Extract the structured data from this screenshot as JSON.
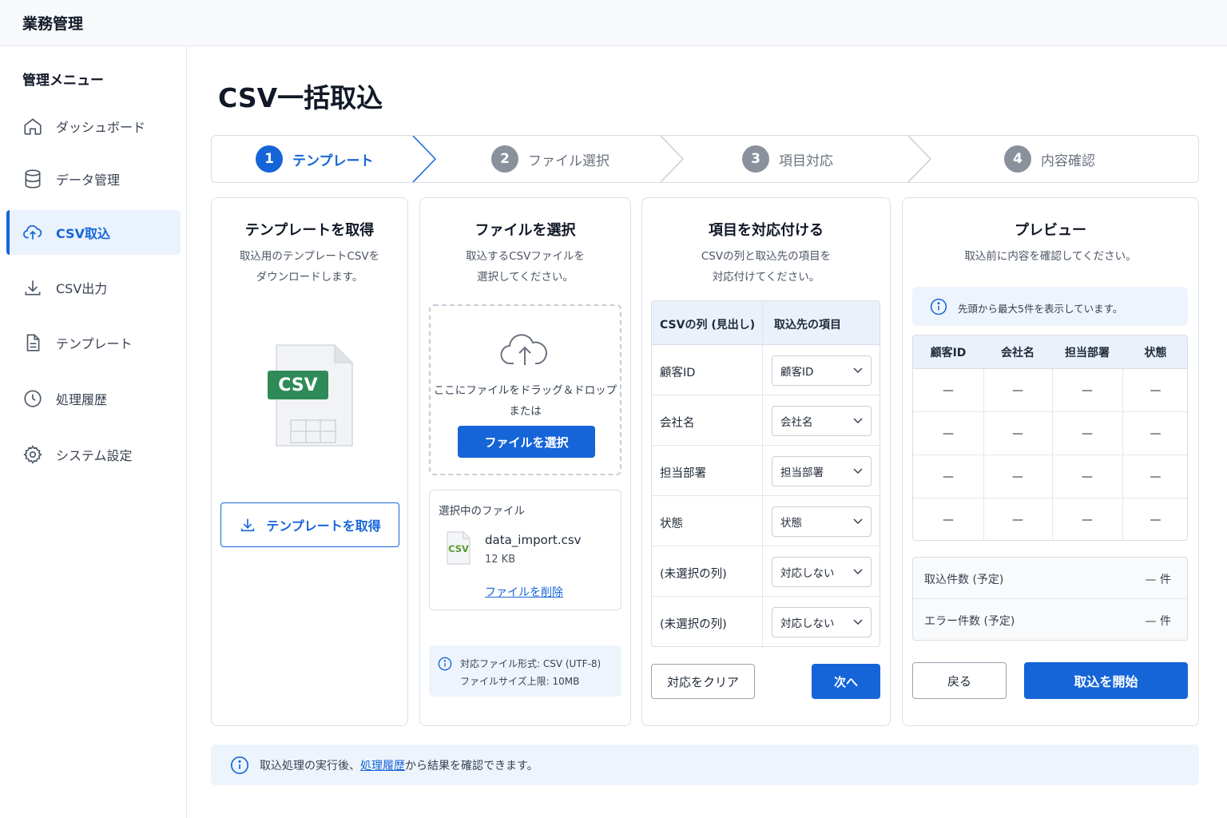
{
  "app": {
    "title": "業務管理"
  },
  "sidebar": {
    "title": "管理メニュー",
    "items": [
      {
        "label": "ダッシュボード",
        "icon": "home-icon"
      },
      {
        "label": "データ管理",
        "icon": "database-icon"
      },
      {
        "label": "CSV取込",
        "icon": "cloud-upload-icon",
        "active": true
      },
      {
        "label": "CSV出力",
        "icon": "download-icon"
      },
      {
        "label": "テンプレート",
        "icon": "document-icon"
      },
      {
        "label": "処理履歴",
        "icon": "clock-icon"
      },
      {
        "label": "システム設定",
        "icon": "gear-icon"
      }
    ]
  },
  "page": {
    "title": "CSV一括取込"
  },
  "steps": [
    {
      "num": "1",
      "label": "テンプレート",
      "active": true
    },
    {
      "num": "2",
      "label": "ファイル選択"
    },
    {
      "num": "3",
      "label": "項目対応"
    },
    {
      "num": "4",
      "label": "内容確認"
    }
  ],
  "template_card": {
    "title": "テンプレートを取得",
    "desc1": "取込用のテンプレートCSVを",
    "desc2": "ダウンロードします。",
    "file_badge": "CSV",
    "button": "テンプレートを取得"
  },
  "file_card": {
    "title": "ファイルを選択",
    "desc1": "取込するCSVファイルを",
    "desc2": "選択してください。",
    "drop_text": "ここにファイルをドラッグ＆ドロップ",
    "or_text": "または",
    "select_button": "ファイルを選択",
    "selected_label": "選択中のファイル",
    "file_icon_label": "CSV",
    "file_name": "data_import.csv",
    "file_size": "12 KB",
    "delete_link": "ファイルを削除",
    "info1": "対応ファイル形式: CSV (UTF-8)",
    "info2": "ファイルサイズ上限: 10MB"
  },
  "mapping_card": {
    "title": "項目を対応付ける",
    "desc1": "CSVの列と取込先の項目を",
    "desc2": "対応付けてください。",
    "col_csv": "CSVの列 (見出し)",
    "col_target": "取込先の項目",
    "rows": [
      {
        "csv": "顧客ID",
        "target": "顧客ID"
      },
      {
        "csv": "会社名",
        "target": "会社名"
      },
      {
        "csv": "担当部署",
        "target": "担当部署"
      },
      {
        "csv": "状態",
        "target": "状態"
      },
      {
        "csv": "(未選択の列)",
        "target": "対応しない"
      },
      {
        "csv": "(未選択の列)",
        "target": "対応しない"
      }
    ],
    "clear_button": "対応をクリア",
    "next_button": "次へ"
  },
  "preview_card": {
    "title": "プレビュー",
    "desc": "取込前に内容を確認してください。",
    "notice": "先頭から最大5件を表示しています。",
    "columns": [
      "顧客ID",
      "会社名",
      "担当部署",
      "状態"
    ],
    "rows": [
      [
        "—",
        "—",
        "—",
        "—"
      ],
      [
        "—",
        "—",
        "—",
        "—"
      ],
      [
        "—",
        "—",
        "—",
        "—"
      ],
      [
        "—",
        "—",
        "—",
        "—"
      ]
    ],
    "import_count_label": "取込件数 (予定)",
    "import_count_value": "— 件",
    "error_count_label": "エラー件数 (予定)",
    "error_count_value": "— 件",
    "back_button": "戻る",
    "start_button": "取込を開始"
  },
  "footer": {
    "text_before": "取込処理の実行後、",
    "link": "処理履歴",
    "text_after": "から結果を確認できます。"
  },
  "colors": {
    "accent": "#1565d8",
    "info_bg": "#eef4fc",
    "csv_green": "#2e8b57"
  }
}
